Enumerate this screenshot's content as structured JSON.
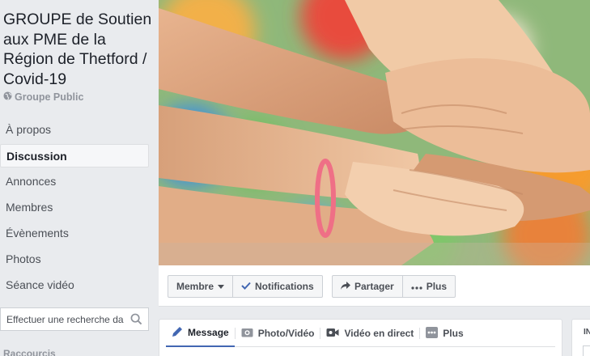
{
  "sidebar": {
    "group_title": "GROUPE de Soutien aux PME de la Région de Thetford / Covid-19",
    "privacy": "Groupe Public",
    "items": [
      {
        "label": "À propos"
      },
      {
        "label": "Discussion"
      },
      {
        "label": "Annonces"
      },
      {
        "label": "Membres"
      },
      {
        "label": "Évènements"
      },
      {
        "label": "Photos"
      },
      {
        "label": "Séance vidéo"
      }
    ],
    "search_placeholder": "Effectuer une recherche dans ce groupe",
    "shortcuts_label": "Raccourcis"
  },
  "actions": {
    "member": "Membre",
    "notifications": "Notifications",
    "share": "Partager",
    "more": "Plus"
  },
  "composer": {
    "tabs": [
      {
        "label": "Message"
      },
      {
        "label": "Photo/Vidéo"
      },
      {
        "label": "Vidéo en direct"
      },
      {
        "label": "Plus"
      }
    ]
  },
  "right_panel": {
    "label": "IN"
  },
  "colors": {
    "accent": "#4267b2",
    "background": "#e9ebee"
  }
}
